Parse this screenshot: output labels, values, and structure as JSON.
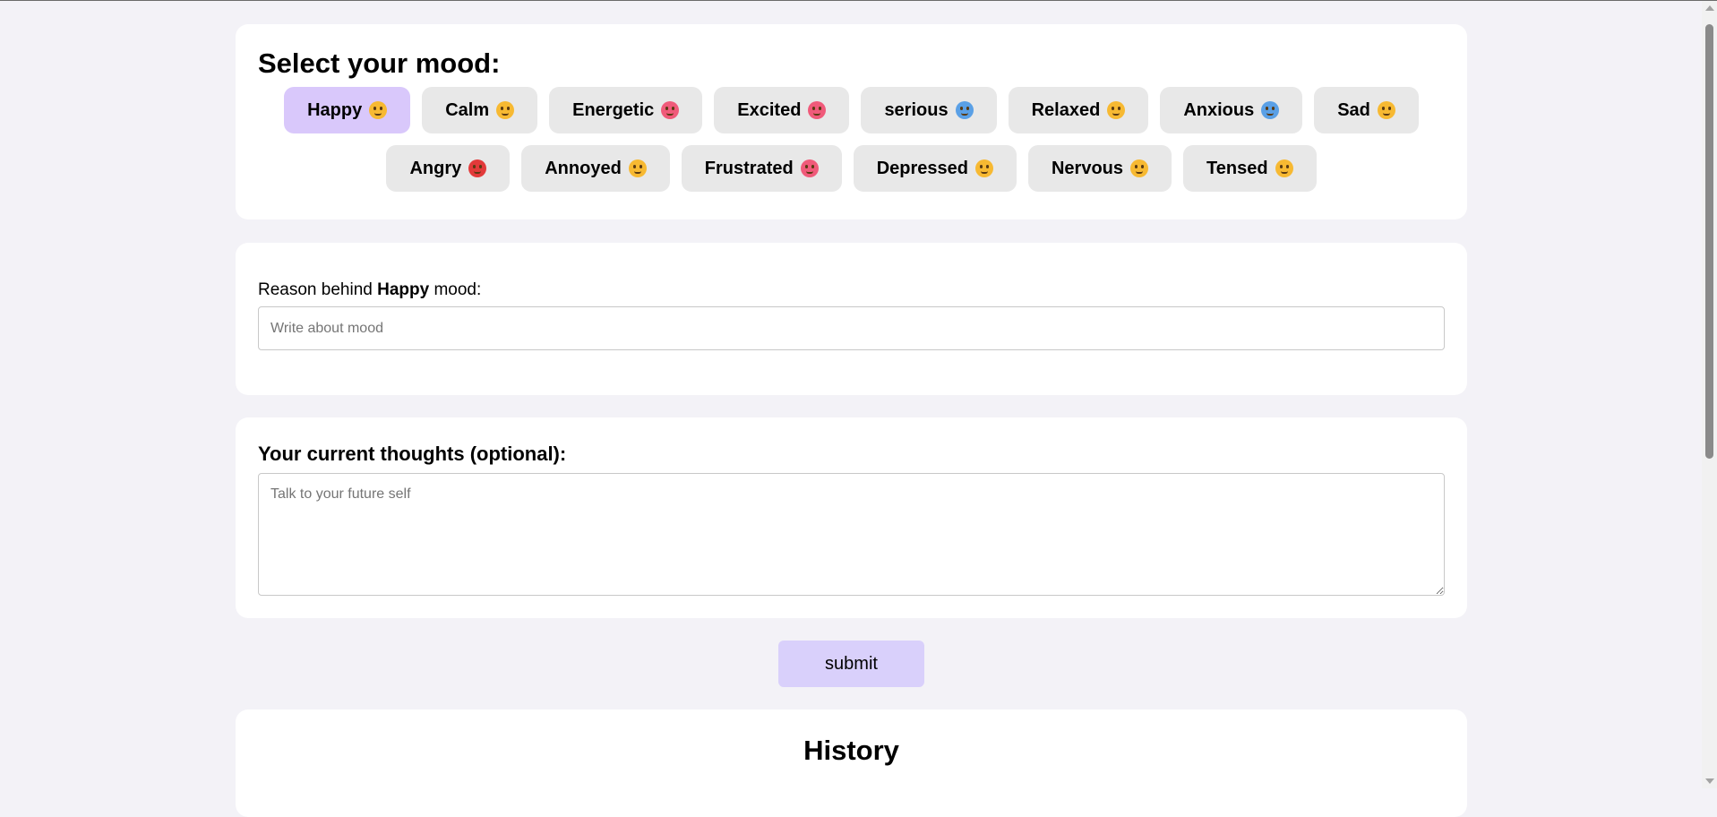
{
  "mood_section": {
    "title": "Select your mood:",
    "selected": "Happy",
    "moods_row1": [
      {
        "label": "Happy",
        "emoji_color": "#f7b932"
      },
      {
        "label": "Calm",
        "emoji_color": "#f7b932"
      },
      {
        "label": "Energetic",
        "emoji_color": "#f05a7a"
      },
      {
        "label": "Excited",
        "emoji_color": "#f05a7a"
      },
      {
        "label": "serious",
        "emoji_color": "#5aa0e6"
      },
      {
        "label": "Relaxed",
        "emoji_color": "#f7b932"
      },
      {
        "label": "Anxious",
        "emoji_color": "#5aa0e6"
      },
      {
        "label": "Sad",
        "emoji_color": "#f7b932"
      }
    ],
    "moods_row2": [
      {
        "label": "Angry",
        "emoji_color": "#e23a3a"
      },
      {
        "label": "Annoyed",
        "emoji_color": "#f7b932"
      },
      {
        "label": "Frustrated",
        "emoji_color": "#f05a7a"
      },
      {
        "label": "Depressed",
        "emoji_color": "#f7b932"
      },
      {
        "label": "Nervous",
        "emoji_color": "#f7b932"
      },
      {
        "label": "Tensed",
        "emoji_color": "#f7b932"
      }
    ]
  },
  "reason_section": {
    "label_prefix": "Reason behind",
    "label_mood": "Happy",
    "label_suffix": "mood:",
    "placeholder": "Write about mood",
    "value": ""
  },
  "thoughts_section": {
    "label": "Your current thoughts (optional):",
    "placeholder": "Talk to your future self",
    "value": ""
  },
  "submit_label": "submit",
  "history": {
    "title": "History"
  },
  "colors": {
    "page_bg": "#f3f2f7",
    "selected_mood_bg": "#d9c8fb",
    "mood_btn_bg": "#e8e8e8",
    "submit_bg": "#d9d0fb"
  }
}
